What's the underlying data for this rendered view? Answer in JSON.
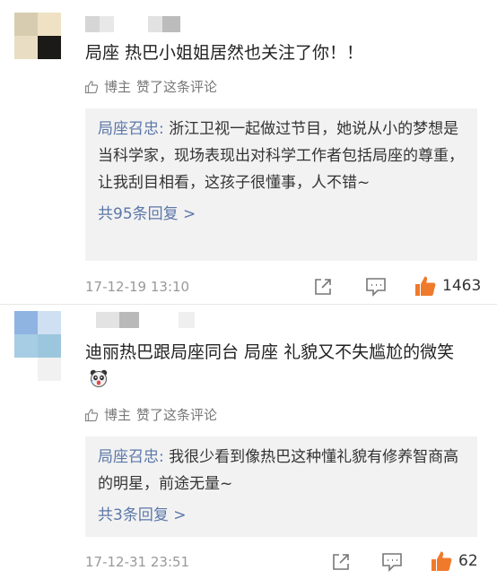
{
  "comments": [
    {
      "text": "局座  热巴小姐姐居然也关注了你！！",
      "liked_by": "博主",
      "liked_action": "赞了这条评论",
      "reply_author": "局座召忠:",
      "reply_text": " 浙江卫视一起做过节目，她说从小的梦想是当科学家，现场表现出对科学工作者包括局座的尊重，让我刮目相看，这孩子很懂事，人不错~",
      "reply_more": "共95条回复 >",
      "time": "17-12-19 13:10",
      "likes": "1463"
    },
    {
      "text": "迪丽热巴跟局座同台  局座  礼貌又不失尴尬的微笑",
      "liked_by": "博主",
      "liked_action": "赞了这条评论",
      "reply_author": "局座召忠:",
      "reply_text": " 我很少看到像热巴这种懂礼貌有修养智商高的明星，前途无量~",
      "reply_more": "共3条回复 >",
      "time": "17-12-31 23:51",
      "likes": "62"
    }
  ],
  "colors": {
    "link": "#5b77a8",
    "like_orange": "#f07a2b",
    "reply_bg": "#f2f2f2"
  },
  "icons": [
    "thumb-up-outline-icon",
    "share-icon",
    "reply-icon",
    "thumb-up-filled-icon",
    "panda-emoji-icon"
  ]
}
